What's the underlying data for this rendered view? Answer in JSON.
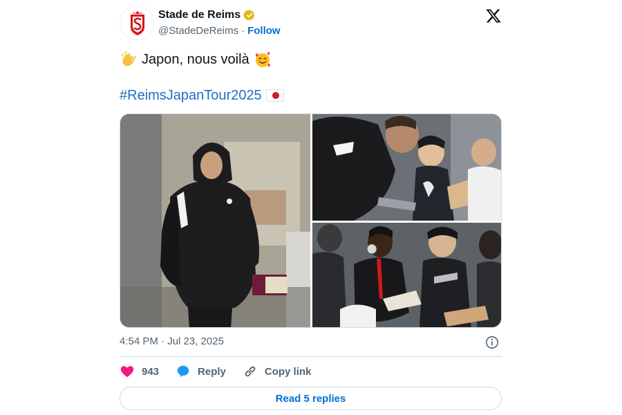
{
  "header": {
    "name": "Stade de Reims",
    "handle": "@StadeDeReims",
    "separator": "·",
    "follow_label": "Follow",
    "verified_color": "#E2B719",
    "avatar_icon": "reims-crest",
    "platform_icon": "x-logo"
  },
  "tweet": {
    "line1_emoji": "clapping-hands",
    "line1_text": "Japon, nous voilà",
    "line1_emoji_end": "smiling-face-with-hearts",
    "hashtag": "#ReimsJapanTour2025",
    "flag": "japan-flag"
  },
  "media": {
    "photos": [
      "player-in-hoodie-with-passport",
      "player-signing-autograph-for-child",
      "players-signing-for-fans"
    ]
  },
  "meta": {
    "timestamp": "4:54 PM · Jul 23, 2025"
  },
  "actions": {
    "like_count": "943",
    "reply_label": "Reply",
    "copy_link_label": "Copy link",
    "like_color": "#F91880",
    "reply_color": "#1D9BF0"
  },
  "footer": {
    "read_replies_label": "Read 5 replies"
  }
}
